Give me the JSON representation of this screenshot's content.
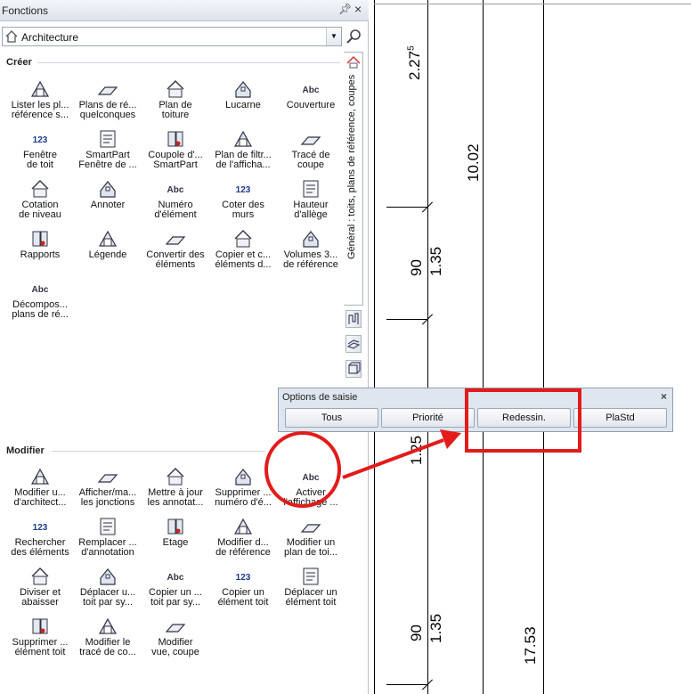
{
  "palette": {
    "title": "Fonctions",
    "pin_icon": "pin-icon",
    "close_icon": "close-icon",
    "combo_value": "Architecture",
    "section_create": "Créer",
    "section_modify": "Modifier",
    "vertical_tab": "Général : toits, plans de référence, coupes"
  },
  "create_tools": [
    {
      "label": "Lister les pl...\nréférence s...",
      "icon": "list-planes-icon"
    },
    {
      "label": "Plans de ré...\nquelconques",
      "icon": "reference-planes-icon"
    },
    {
      "label": "Plan de\ntoiture",
      "icon": "roof-plan-icon"
    },
    {
      "label": "Lucarne",
      "icon": "dormer-icon"
    },
    {
      "label": "Couverture",
      "icon": "roof-covering-icon"
    },
    {
      "label": "Fenêtre\nde toit",
      "icon": "roof-window-icon"
    },
    {
      "label": "SmartPart\nFenêtre de ...",
      "icon": "smartpart-window-icon"
    },
    {
      "label": "Coupole d'...\nSmartPart",
      "icon": "dome-icon"
    },
    {
      "label": "Plan de filtr...\nde l'afficha...",
      "icon": "filter-plane-icon"
    },
    {
      "label": "Tracé de\ncoupe",
      "icon": "section-line-icon"
    },
    {
      "label": "Cotation\nde niveau",
      "icon": "level-dimension-icon"
    },
    {
      "label": "Annoter",
      "icon": "annotate-icon"
    },
    {
      "label": "Numéro\nd'élément",
      "icon": "element-number-icon"
    },
    {
      "label": "Coter des\nmurs",
      "icon": "dimension-walls-icon"
    },
    {
      "label": "Hauteur\nd'allège",
      "icon": "sill-height-icon"
    },
    {
      "label": "Rapports",
      "icon": "reports-icon"
    },
    {
      "label": "Légende",
      "icon": "legend-icon"
    },
    {
      "label": "Convertir des\néléments",
      "icon": "convert-elements-icon"
    },
    {
      "label": "Copier et c...\néléments d...",
      "icon": "copy-elements-icon"
    },
    {
      "label": "Volumes 3...\nde référence",
      "icon": "reference-volumes-icon"
    },
    {
      "label": "Décompos...\nplans de ré...",
      "icon": "decompose-planes-icon"
    }
  ],
  "modify_tools": [
    {
      "label": "Modifier u...\nd'architect...",
      "icon": "modify-arch-icon"
    },
    {
      "label": "Afficher/ma...\nles jonctions",
      "icon": "show-junctions-icon"
    },
    {
      "label": "Mettre à jour\nles annotat...",
      "icon": "update-annotations-icon"
    },
    {
      "label": "Supprimer ...\nnuméro d'é...",
      "icon": "delete-number-icon"
    },
    {
      "label": "Activer\nl'affichage ...",
      "icon": "activate-display-icon"
    },
    {
      "label": "Rechercher\ndes éléments",
      "icon": "search-elements-icon"
    },
    {
      "label": "Remplacer ...\nd'annotation",
      "icon": "replace-annotation-icon"
    },
    {
      "label": "Etage",
      "icon": "storey-icon"
    },
    {
      "label": "Modifier d...\nde référence",
      "icon": "modify-reference-icon"
    },
    {
      "label": "Modifier un\nplan de toi...",
      "icon": "modify-roof-plane-icon"
    },
    {
      "label": "Diviser et\nabaisser",
      "icon": "divide-lower-icon"
    },
    {
      "label": "Déplacer u...\ntoit par sy...",
      "icon": "move-roof-icon"
    },
    {
      "label": "Copier un ...\ntoit par sy...",
      "icon": "copy-roof-icon"
    },
    {
      "label": "Copier un\nélément toit",
      "icon": "copy-roof-element-icon"
    },
    {
      "label": "Déplacer un\nélément toit",
      "icon": "move-roof-element-icon"
    },
    {
      "label": "Supprimer ...\nélément toit",
      "icon": "delete-roof-element-icon"
    },
    {
      "label": "Modifier le\ntracé de co...",
      "icon": "modify-section-line-icon"
    },
    {
      "label": "Modifier\nvue, coupe",
      "icon": "modify-view-icon"
    }
  ],
  "options_dialog": {
    "title": "Options de saisie",
    "buttons": [
      "Tous",
      "Priorité",
      "Redessin.",
      "PlaStd"
    ]
  },
  "drawing": {
    "dim_top": "2.27",
    "dim_top_sup": "5",
    "dim_long_top": "10.02",
    "dim_90_a": "90",
    "dim_135_a": "1.35",
    "dim_mid": "1.25",
    "dim_90_b": "90",
    "dim_135_b": "1.35",
    "dim_long_bottom": "17.53"
  },
  "colors": {
    "accent_red": "#e21b1b",
    "toolbar_bg": "#dfe6ef"
  }
}
